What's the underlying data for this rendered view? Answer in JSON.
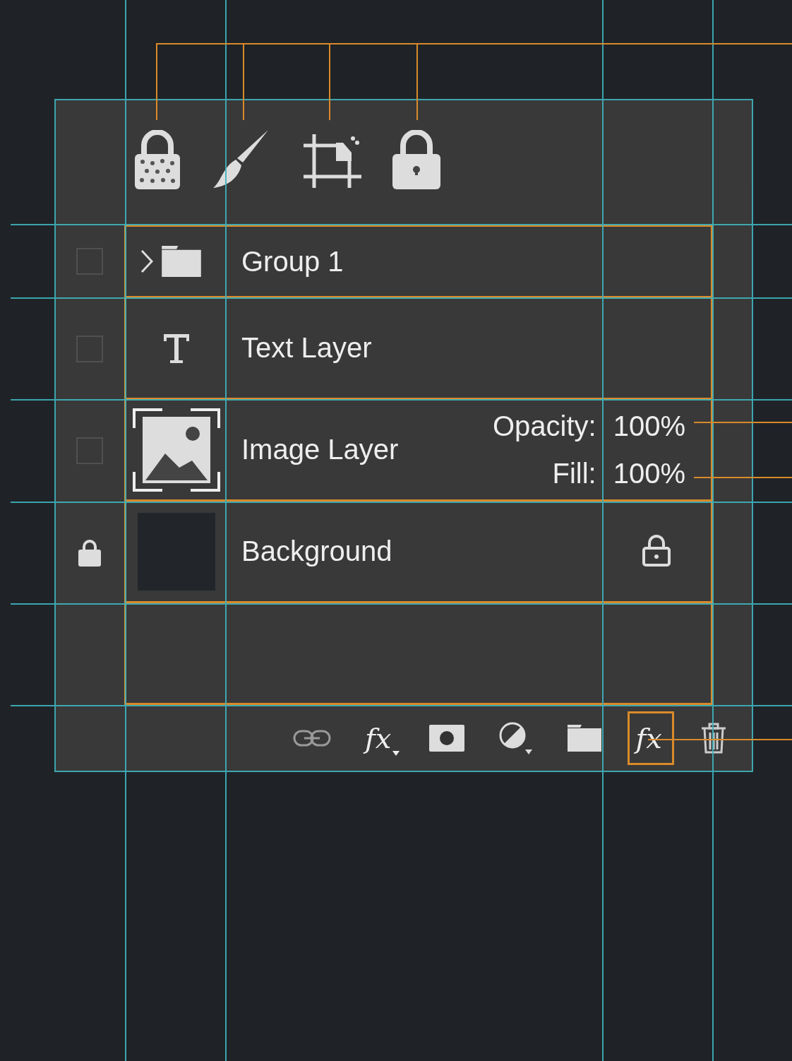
{
  "lock_toolbar": [
    {
      "kind": "transparent",
      "selected": false
    },
    {
      "kind": "paint",
      "selected": false
    },
    {
      "kind": "position",
      "selected": false
    },
    {
      "kind": "all",
      "selected": false
    }
  ],
  "layers": [
    {
      "name": "Group 1",
      "kind": "group",
      "locked": false,
      "checked": false,
      "expanded": false
    },
    {
      "name": "Text Layer",
      "kind": "text",
      "locked": false,
      "checked": false
    },
    {
      "name": "Image Layer",
      "kind": "image",
      "locked": false,
      "checked": false,
      "opacity_label": "Opacity:",
      "opacity": "100%",
      "fill_label": "Fill:",
      "fill": "100%"
    },
    {
      "name": "Background",
      "kind": "background",
      "locked": true
    }
  ],
  "footer_toolbar": [
    {
      "kind": "link",
      "selected": false
    },
    {
      "kind": "fx",
      "label": "fx",
      "selected": false
    },
    {
      "kind": "mask",
      "selected": false
    },
    {
      "kind": "adjustment",
      "selected": false
    },
    {
      "kind": "folder",
      "selected": false
    },
    {
      "kind": "fx",
      "label": "fx",
      "selected": true
    },
    {
      "kind": "trash",
      "selected": false
    }
  ]
}
